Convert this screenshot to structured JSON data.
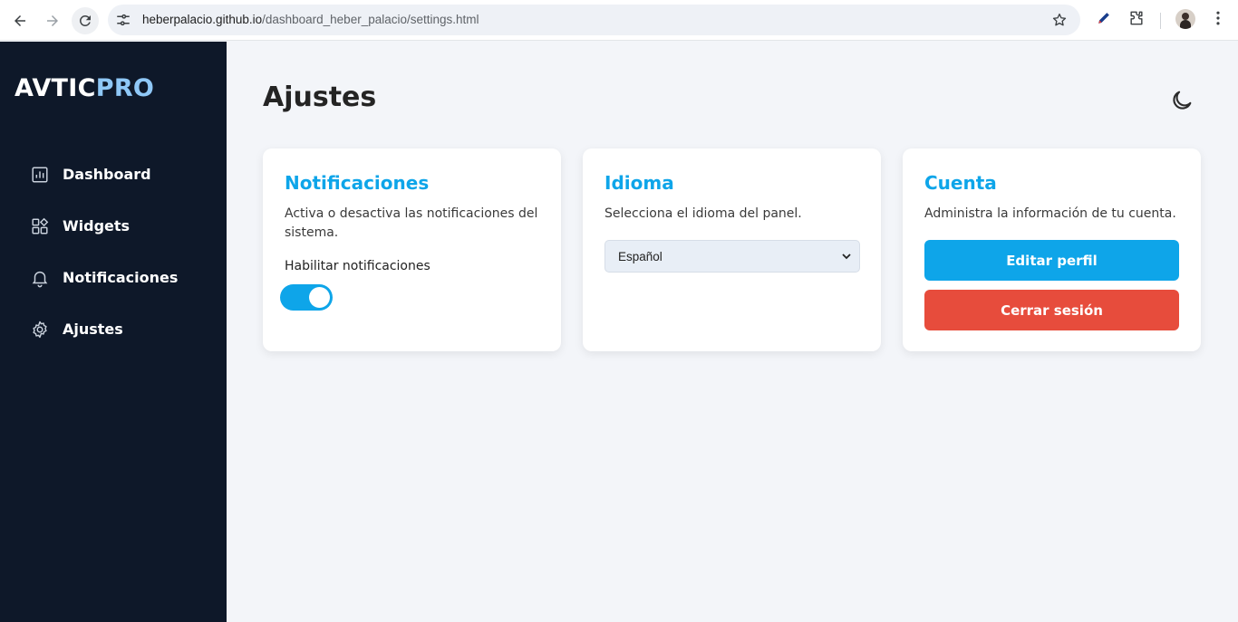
{
  "browser": {
    "url_host": "heberpalacio.github.io",
    "url_path": "/dashboard_heber_palacio/settings.html"
  },
  "sidebar": {
    "logo_main": "AVTIC",
    "logo_accent": "PRO",
    "items": [
      {
        "label": "Dashboard",
        "icon": "chart-icon"
      },
      {
        "label": "Widgets",
        "icon": "widgets-icon"
      },
      {
        "label": "Notificaciones",
        "icon": "bell-icon"
      },
      {
        "label": "Ajustes",
        "icon": "gear-icon"
      }
    ]
  },
  "main": {
    "title": "Ajustes"
  },
  "cards": {
    "notifications": {
      "title": "Notificaciones",
      "description": "Activa o desactiva las notificaciones del sistema.",
      "toggle_label": "Habilitar notificaciones",
      "toggle_on": true
    },
    "language": {
      "title": "Idioma",
      "description": "Selecciona el idioma del panel.",
      "selected": "Español"
    },
    "account": {
      "title": "Cuenta",
      "description": "Administra la información de tu cuenta.",
      "edit_label": "Editar perfil",
      "logout_label": "Cerrar sesión"
    }
  },
  "colors": {
    "sidebar_bg": "#0e1829",
    "accent": "#0ea5e9",
    "logo_accent": "#8fc8f7",
    "danger": "#e74c3c",
    "page_bg": "#f3f5f9"
  }
}
